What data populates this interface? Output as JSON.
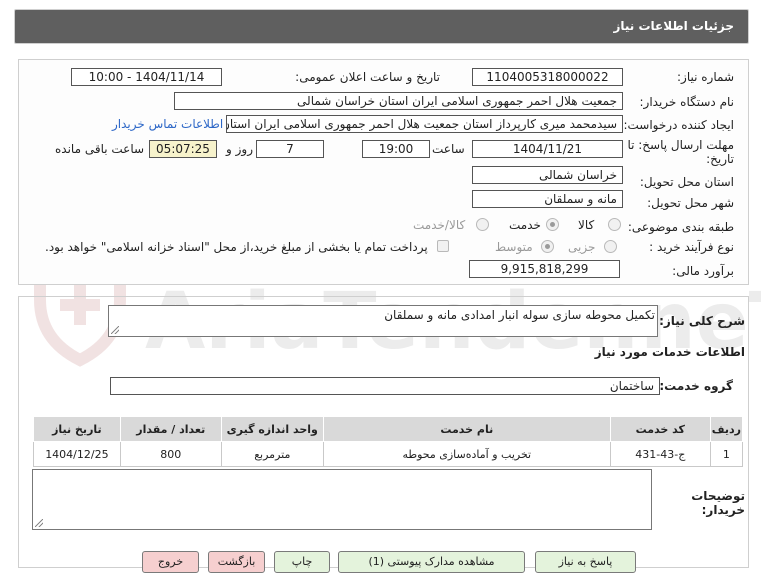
{
  "header": {
    "title": "جزئیات اطلاعات نیاز"
  },
  "form": {
    "need_number_label": "شماره نیاز:",
    "need_number": "1104005318000022",
    "announce_label": "تاریخ و ساعت اعلان عمومی:",
    "announce_value": "1404/11/14 - 10:00",
    "buyer_org_label": "نام دستگاه خریدار:",
    "buyer_org": "جمعیت هلال احمر جمهوری اسلامی ایران استان خراسان شمالی",
    "creator_label": "ایجاد کننده درخواست:",
    "creator": "سیدمحمد میری کارپرداز استان جمعیت هلال احمر جمهوری اسلامی ایران استان خ",
    "contact_link": "اطلاعات تماس خریدار",
    "deadline_label_1": "مهلت ارسال پاسخ: تا",
    "deadline_label_2": "تاریخ:",
    "deadline_date": "1404/11/21",
    "time_label": "ساعت",
    "deadline_time": "19:00",
    "days": "7",
    "days_label": "روز و",
    "remaining_time": "05:07:25",
    "remaining_label": "ساعت باقی مانده",
    "province_label": "استان محل تحویل:",
    "province": "خراسان شمالی",
    "city_label": "شهر محل تحویل:",
    "city": "مانه و سملقان",
    "category_label": "طبقه بندی موضوعی:",
    "category_options": [
      "کالا",
      "خدمت",
      "کالا/خدمت"
    ],
    "category_selected": "خدمت",
    "process_label": "نوع فرآیند خرید :",
    "process_options": [
      "جزیی",
      "متوسط"
    ],
    "process_selected": "متوسط",
    "treasury_note": "پرداخت تمام یا بخشی از مبلغ خرید،از محل \"اسناد خزانه اسلامی\" خواهد بود.",
    "estimate_label": "برآورد مالی:",
    "estimate": "9,915,818,299"
  },
  "summary": {
    "label": "شرح کلی نیاز:",
    "text": "تکمیل محوطه سازی سوله انبار امدادی مانه و سملقان"
  },
  "services": {
    "section_title": "اطلاعات خدمات مورد نیاز",
    "group_label": "گروه خدمت:",
    "group_value": "ساختمان",
    "columns": [
      "ردیف",
      "کد خدمت",
      "نام خدمت",
      "واحد اندازه گیری",
      "تعداد / مقدار",
      "تاریخ نیاز"
    ],
    "rows": [
      {
        "index": "1",
        "code": "ج-43-431",
        "name": "تخریب و آماده‌سازی محوطه",
        "unit": "مترمربع",
        "qty": "800",
        "date": "1404/12/25"
      }
    ]
  },
  "buyer_notes": {
    "label_1": "توضیحات",
    "label_2": "خریدار:"
  },
  "buttons": {
    "reply": "پاسخ به نیاز",
    "attachments": "مشاهده مدارک پیوستی (1)",
    "print": "چاپ",
    "back": "بازگشت",
    "exit": "خروج"
  },
  "watermark": {
    "text": "AriaTender.neT"
  },
  "colors": {
    "header_bg": "#5f5f5f",
    "link": "#2d67c7",
    "remaining_bg": "#f7f3cc",
    "btn_green": "#e4f3dc",
    "btn_pink": "#f6cfcf"
  }
}
